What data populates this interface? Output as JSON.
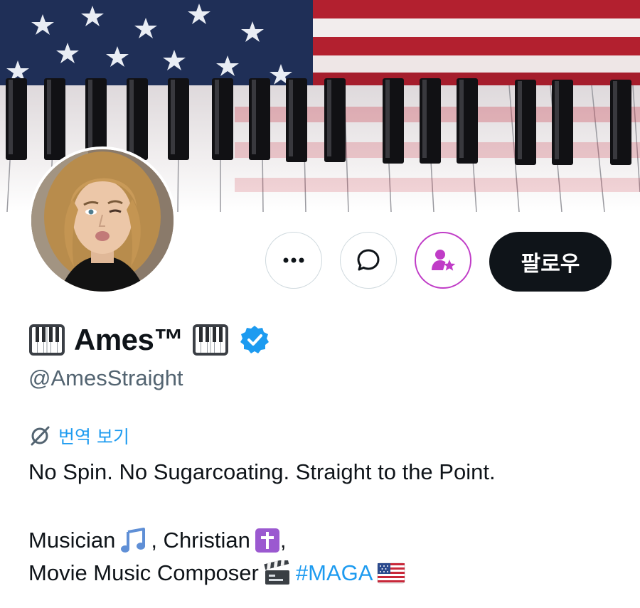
{
  "profile": {
    "display_name": "Ames™",
    "handle": "@AmesStraight",
    "verified": true
  },
  "actions": {
    "more_icon": "more-dots-icon",
    "message_icon": "message-bubble-icon",
    "subscribe_icon": "subscribe-person-star-icon",
    "follow_label": "팔로우"
  },
  "translate": {
    "label": "번역 보기",
    "icon": "translate-slash-icon"
  },
  "bio": {
    "line1": "No Spin. No Sugarcoating. Straight to the Point.",
    "musician": "Musician",
    "christian": ", Christian",
    "comma": ",",
    "composer": "Movie Music Composer",
    "hashtag": "#MAGA"
  },
  "colors": {
    "accent_blue": "#1d9bf0",
    "subscribe_purple": "#c03cc7",
    "follow_bg": "#0f1419",
    "muted_text": "#536471"
  }
}
